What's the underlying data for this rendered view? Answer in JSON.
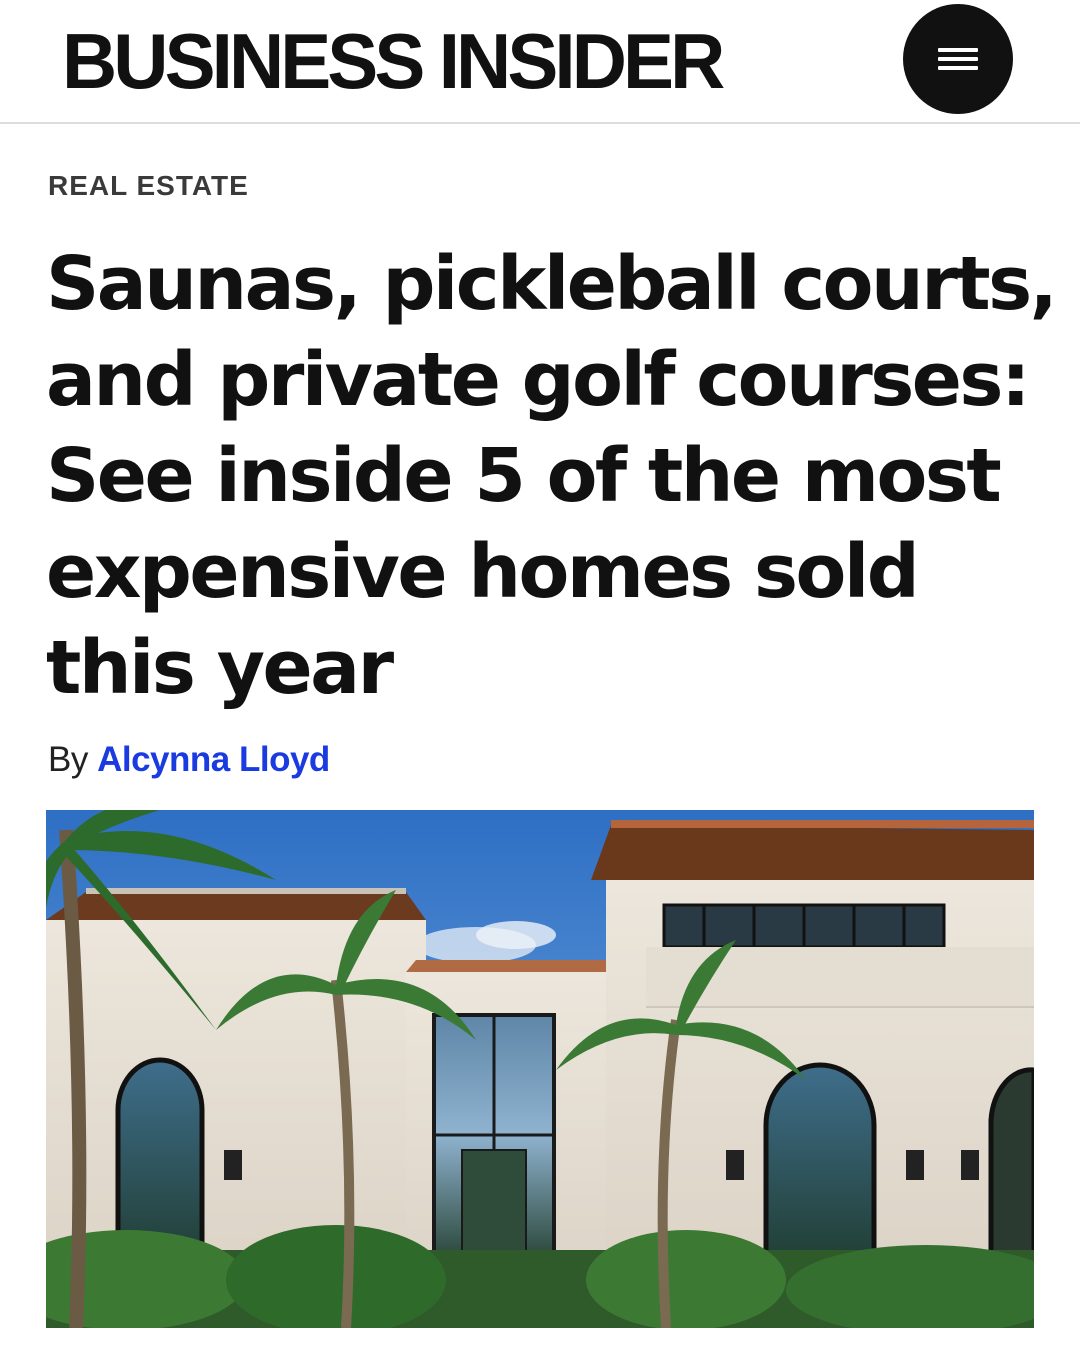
{
  "header": {
    "logo": "BUSINESS INSIDER",
    "menu_icon": "hamburger-menu-icon"
  },
  "article": {
    "category": "REAL ESTATE",
    "headline_lines": [
      "Saunas, pickleball courts,",
      "and private golf courses:",
      "See inside 5 of the most",
      "expensive homes sold",
      "this year"
    ],
    "byline_prefix": "By",
    "author": "Alcynna Lloyd",
    "hero_image": "luxury-mansion-with-palm-trees-photo"
  },
  "colors": {
    "author_link": "#1a3be0",
    "header_border": "#dcdcdc"
  }
}
